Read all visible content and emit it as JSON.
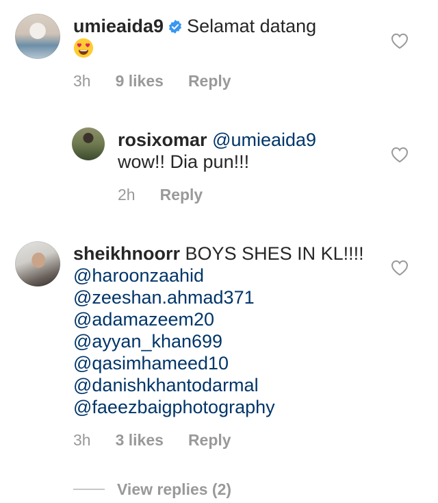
{
  "comments": [
    {
      "username": "umieaida9",
      "verified": true,
      "text": "Selamat datang",
      "emoji": "😍",
      "time": "3h",
      "likes": "9 likes",
      "reply": "Reply"
    },
    {
      "username": "rosixomar",
      "mention": "@umieaida9",
      "text": "wow!! Dia pun!!!",
      "time": "2h",
      "reply": "Reply"
    },
    {
      "username": "sheikhnoorr",
      "text": "BOYS SHES IN KL!!!!",
      "mentions": [
        "@haroonzaahid",
        "@zeeshan.ahmad371",
        "@adamazeem20",
        "@ayyan_khan699",
        "@qasimhameed10",
        "@danishkhantodarmal",
        "@faeezbaigphotography"
      ],
      "time": "3h",
      "likes": "3 likes",
      "reply": "Reply",
      "view_replies": "View replies (2)"
    }
  ],
  "colors": {
    "text": "#262626",
    "meta": "#999999",
    "mention": "#003569",
    "verified": "#3897f0"
  },
  "icons": [
    "verified-badge-icon",
    "heart-icon",
    "heart-eyes-emoji"
  ]
}
